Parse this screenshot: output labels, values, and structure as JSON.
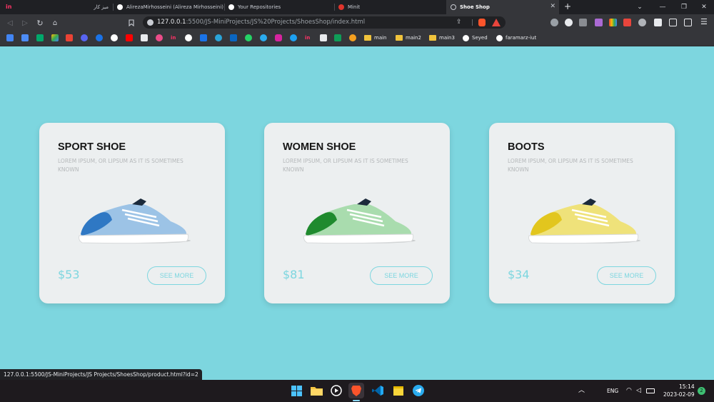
{
  "browser": {
    "tabs": [
      {
        "label": "میز کار",
        "active": false
      },
      {
        "label": "AlirezaMirhosseini (Alireza Mirhosseini)",
        "active": false
      },
      {
        "label": "Your Repositories",
        "active": false
      },
      {
        "label": "Minit",
        "active": false
      },
      {
        "label": "Shoe Shop",
        "active": true
      }
    ],
    "url": {
      "host": "127.0.0.1",
      "rest": ":5500/JS-MiniProjects/JS%20Projects/ShoesShop/index.html"
    },
    "bookmarks": {
      "folders": [
        "main",
        "main2",
        "main3"
      ],
      "profiles": [
        "Seyed",
        "faramarz-iut"
      ]
    },
    "status_url": "127.0.0.1:5500/JS-MiniProjects/JS Projects/ShoesShop/product.html?id=2"
  },
  "products": [
    {
      "title": "SPORT SHOE",
      "description": "LOREM IPSUM, OR LIPSUM AS IT IS SOMETIMES KNOWN",
      "price": "$53",
      "button": "SEE MORE",
      "shoe_color": "#9cc3e6",
      "accent": "#2f78c4"
    },
    {
      "title": "WOMEN SHOE",
      "description": "LOREM IPSUM, OR LIPSUM AS IT IS SOMETIMES KNOWN",
      "price": "$81",
      "button": "SEE MORE",
      "shoe_color": "#a9dcae",
      "accent": "#1f8a2e"
    },
    {
      "title": "BOOTS",
      "description": "LOREM IPSUM, OR LIPSUM AS IT IS SOMETIMES KNOWN",
      "price": "$34",
      "button": "SEE MORE",
      "shoe_color": "#efe27a",
      "accent": "#e2c61e"
    }
  ],
  "taskbar": {
    "apps": [
      "windows-start-icon",
      "file-explorer-icon",
      "media-player-icon",
      "brave-browser-icon",
      "vscode-icon",
      "sticky-notes-icon",
      "telegram-icon"
    ],
    "language": "ENG",
    "time": "15:14",
    "date": "2023-02-09",
    "notification_count": "2"
  },
  "colors": {
    "page_background": "#7dd6df",
    "card_background": "#eceff0",
    "accent": "#7dd6df"
  }
}
